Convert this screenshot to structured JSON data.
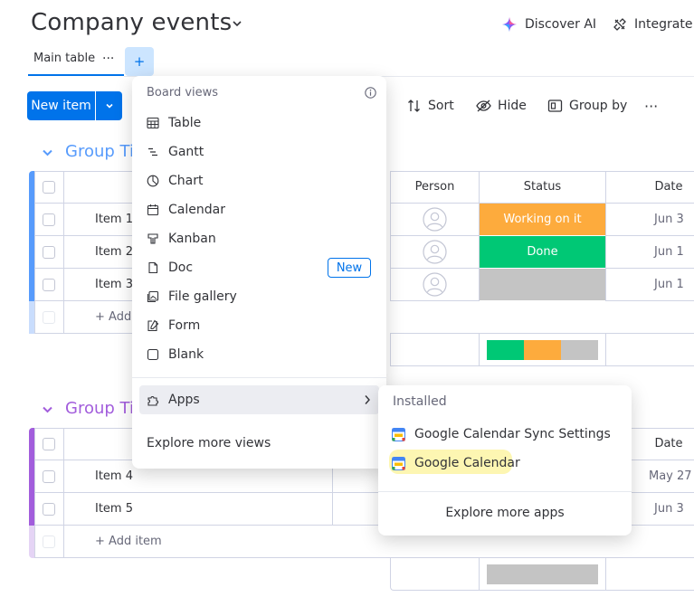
{
  "header": {
    "title": "Company events",
    "discover_ai": "Discover AI",
    "integrate": "Integrate"
  },
  "tabs": {
    "main_table": "Main table",
    "more": "···",
    "add": "+"
  },
  "toolbar": {
    "new_item": "New item",
    "sort": "Sort",
    "hide": "Hide",
    "group_by": "Group by",
    "more": "···"
  },
  "board_views_menu": {
    "heading": "Board views",
    "items": [
      {
        "label": "Table",
        "icon": "table-icon"
      },
      {
        "label": "Gantt",
        "icon": "gantt-icon"
      },
      {
        "label": "Chart",
        "icon": "chart-icon"
      },
      {
        "label": "Calendar",
        "icon": "calendar-icon"
      },
      {
        "label": "Kanban",
        "icon": "kanban-icon"
      },
      {
        "label": "Doc",
        "icon": "doc-icon"
      },
      {
        "label": "File gallery",
        "icon": "file-gallery-icon"
      },
      {
        "label": "Form",
        "icon": "form-icon"
      },
      {
        "label": "Blank",
        "icon": "blank-icon"
      }
    ],
    "doc_badge": "New",
    "apps": "Apps",
    "explore_views": "Explore more views"
  },
  "apps_submenu": {
    "heading": "Installed",
    "items": [
      "Google Calendar Sync Settings",
      "Google Calendar"
    ],
    "explore_apps": "Explore more apps"
  },
  "group1": {
    "title": "Group Ti",
    "color": "#579bfc",
    "columns": {
      "person": "Person",
      "status": "Status",
      "date": "Date"
    },
    "rows": [
      {
        "item": "Item 1",
        "status": "Working on it",
        "status_color": "#fdab3d",
        "date": "Jun 3"
      },
      {
        "item": "Item 2",
        "status": "Done",
        "status_color": "#00c875",
        "date": "Jun 1"
      },
      {
        "item": "Item 3",
        "status": "",
        "status_color": "#c4c4c4",
        "date": "Jun 1"
      }
    ],
    "add_item": "+ Add item"
  },
  "group2": {
    "title": "Group Ti",
    "color": "#a25ddc",
    "columns": {
      "date": "Date"
    },
    "rows": [
      {
        "item": "Item 4",
        "date": "May 27"
      },
      {
        "item": "Item 5",
        "date": "Jun 3"
      }
    ],
    "add_item": "+ Add item"
  },
  "colors": {
    "primary": "#0073ea",
    "working": "#fdab3d",
    "done": "#00c875",
    "empty": "#c4c4c4",
    "highlight": "#fdf6b2"
  }
}
